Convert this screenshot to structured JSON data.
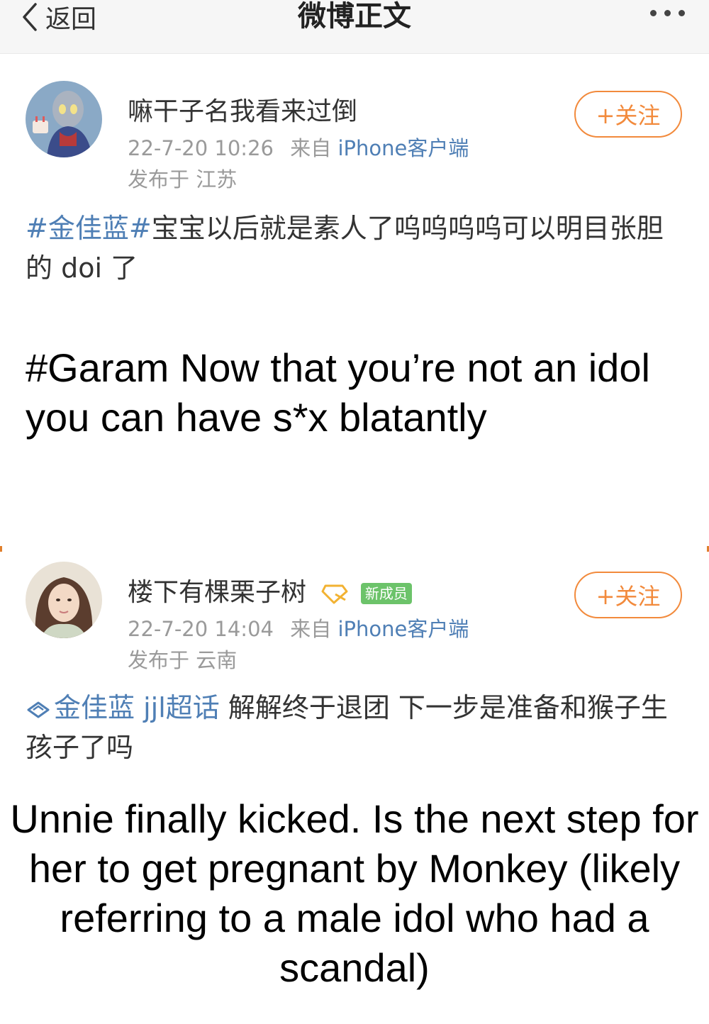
{
  "nav": {
    "back_label": "返回",
    "title": "微博正文",
    "more_icon": "more-dots-icon"
  },
  "colors": {
    "accent_orange": "#f28a3c",
    "link_blue": "#4f7fb5",
    "meta_gray": "#9a9a9a",
    "badge_green": "#6cc36a"
  },
  "posts": [
    {
      "username": "嘛干子名我看来过倒",
      "time": "22-7-20 10:26",
      "from_label": "来自",
      "source": "iPhone客户端",
      "location": "发布于 江苏",
      "follow_label": "+关注",
      "topic": "#金佳蓝#",
      "text": "宝宝以后就是素人了呜呜呜呜可以明目张胆的 doi 了",
      "caption": "#Garam Now that you’re not an idol you can have s*x blatantly"
    },
    {
      "username": "楼下有棵栗子树",
      "badge_label": "新成员",
      "time": "22-7-20 14:04",
      "from_label": "来自",
      "source": "iPhone客户端",
      "location": "发布于 云南",
      "follow_label": "+关注",
      "topic": "金佳蓝 jjl超话",
      "text": " 解解终于退团 下一步是准备和猴子生孩子了吗",
      "caption": "Unnie finally kicked. Is the next step for her to get pregnant by Monkey (likely referring to a male idol who had a scandal)"
    }
  ]
}
